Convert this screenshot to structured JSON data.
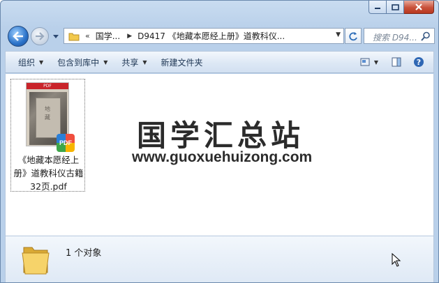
{
  "window": {
    "caption": {
      "minimize_icon": "minimize-icon",
      "maximize_icon": "maximize-icon",
      "close_icon": "close-icon"
    }
  },
  "address": {
    "overflow": "«",
    "breadcrumb": [
      "国学...",
      "D9417 《地藏本愿经上册》道教科仪..."
    ],
    "search_placeholder": "搜索 D94..."
  },
  "toolbar": {
    "organize": "组织",
    "include_library": "包含到库中",
    "share": "共享",
    "new_folder": "新建文件夹"
  },
  "content": {
    "files": [
      {
        "name": "《地藏本愿经上册》道教科仪古籍32页.pdf",
        "name_lines": [
          "《地藏本愿经上",
          "册》道教科仪古籍",
          "32页.pdf"
        ],
        "badge": "PDF",
        "thumb_header": "PDF"
      }
    ],
    "watermark_title": "国学汇总站",
    "watermark_url": "www.guoxuehuizong.com"
  },
  "status": {
    "item_count": "1 个对象"
  },
  "colors": {
    "accent": "#2a72c9",
    "close": "#c8513a",
    "toolbar_text": "#1e3654"
  }
}
